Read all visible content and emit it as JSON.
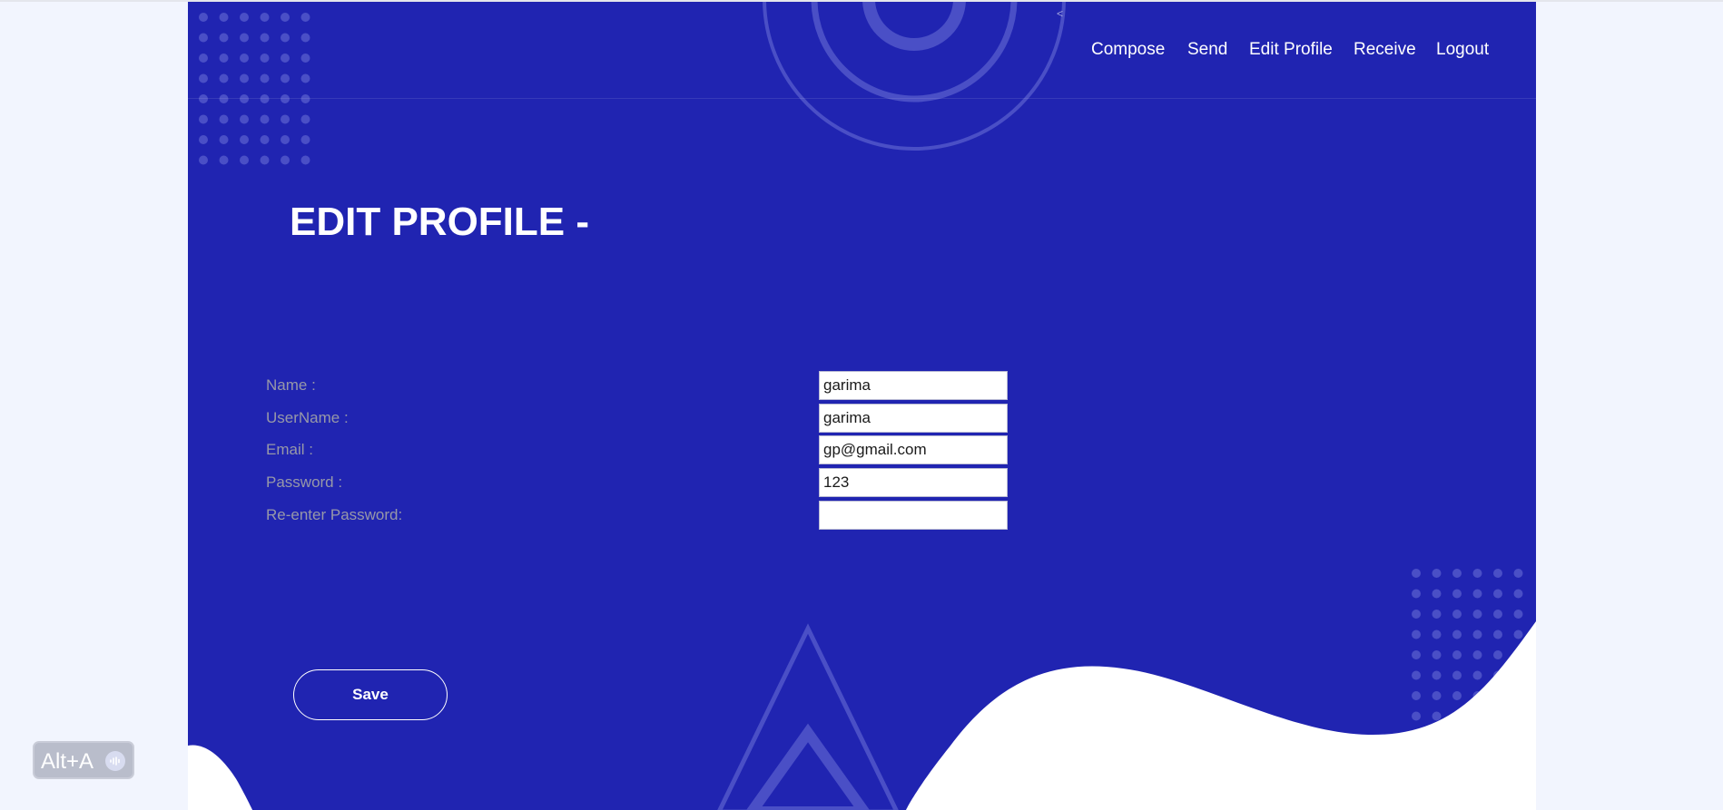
{
  "nav": {
    "links": [
      "Compose",
      "Send",
      "Edit Profile",
      "Receive",
      "Logout"
    ],
    "collapse_icon": "<"
  },
  "page": {
    "title": "EDIT PROFILE -"
  },
  "form": {
    "fields": [
      {
        "label": "Name :",
        "value": "garima"
      },
      {
        "label": "UserName :",
        "value": "garima"
      },
      {
        "label": "Email :",
        "value": "gp@gmail.com"
      },
      {
        "label": "Password :",
        "value": "123"
      },
      {
        "label": "Re-enter Password:",
        "value": ""
      }
    ],
    "save_label": "Save"
  },
  "widget": {
    "label": "Alt+A",
    "icon": "audio-wave-icon"
  },
  "colors": {
    "panel": "#2024b1",
    "page_background": "#f2f5fe",
    "label_text": "#9798a8",
    "decor": "#4a4fc6"
  }
}
